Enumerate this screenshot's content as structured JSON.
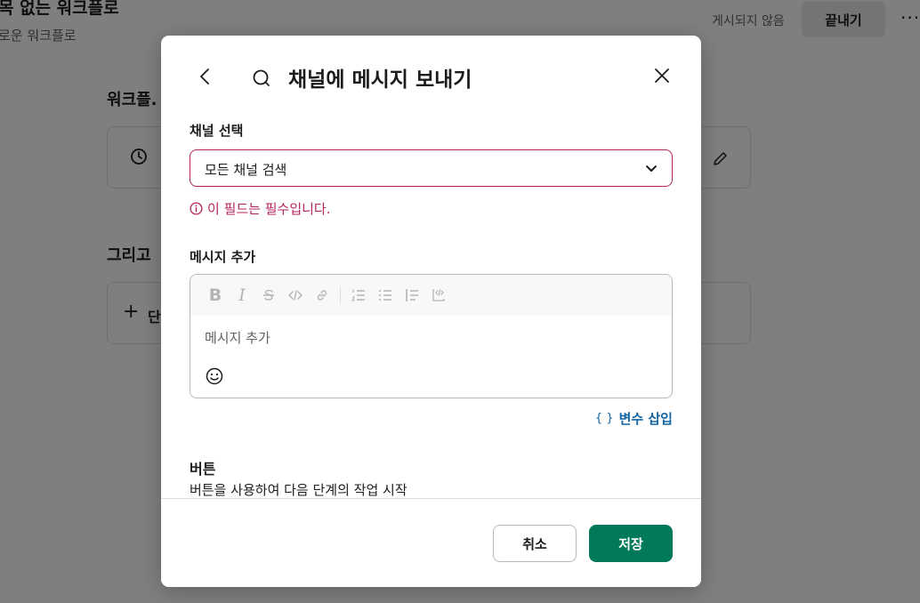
{
  "background": {
    "title": "목 없는 워크플로",
    "subtitle": "로운 워크플로",
    "status": "게시되지 않음",
    "finish_label": "끝내기",
    "more_label": "···",
    "section1_title": "워크플.",
    "section2_title": "그리고",
    "add_step_label": "단"
  },
  "modal": {
    "title": "채널에 메시지 보내기",
    "channel_label": "채널 선택",
    "channel_placeholder": "모든 채널 검색",
    "error_text": "이 필드는 필수입니다.",
    "message_label": "메시지 추가",
    "message_placeholder": "메시지 추가",
    "insert_var_braces": "{ }",
    "insert_var_label": "변수 삽입",
    "buttons_label": "버튼",
    "buttons_desc": "버튼을 사용하여 다음 단계의 작업 시작",
    "cancel_label": "취소",
    "save_label": "저장"
  },
  "toolbar": {
    "bold_glyph": "B",
    "italic_glyph": "I"
  },
  "colors": {
    "error": "#b5245f",
    "primary": "#007a5a",
    "link": "#1264a3"
  },
  "icons": [
    "back-icon",
    "search-icon",
    "close-icon",
    "chevron-down-icon",
    "error-icon",
    "bold-icon",
    "italic-icon",
    "strikethrough-icon",
    "code-icon",
    "link-icon",
    "ordered-list-icon",
    "bullet-list-icon",
    "quote-icon",
    "code-block-icon",
    "emoji-icon",
    "clock-icon",
    "pencil-icon",
    "plus-icon"
  ]
}
